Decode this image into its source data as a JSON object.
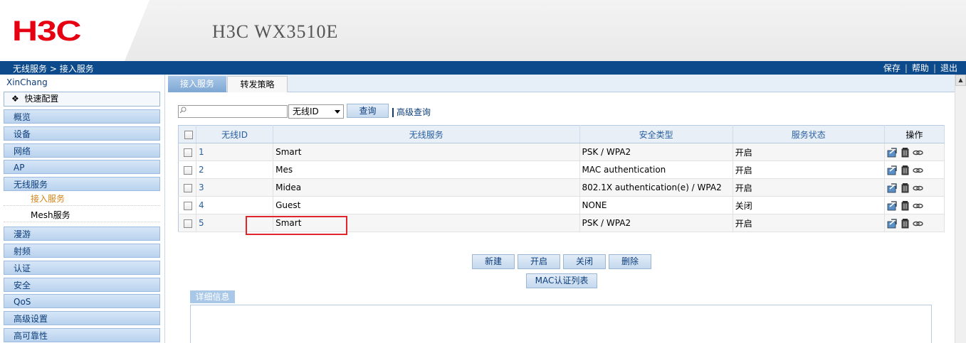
{
  "header": {
    "logo": "H3C",
    "product": "H3C WX3510E"
  },
  "navbar": {
    "crumb_root": "无线服务",
    "crumb_sep": ">",
    "crumb_page": "接入服务",
    "links": {
      "save": "保存",
      "help": "帮助",
      "logout": "退出",
      "sep": "|"
    }
  },
  "sidebar": {
    "site": "XinChang",
    "quick": "快速配置",
    "menu_top": [
      "概览",
      "设备",
      "网络",
      "AP",
      "无线服务"
    ],
    "sub": {
      "access": "接入服务",
      "mesh": "Mesh服务"
    },
    "menu_bottom": [
      "漫游",
      "射频",
      "认证",
      "安全",
      "QoS",
      "高级设置",
      "高可靠性"
    ]
  },
  "tabs": {
    "access": "接入服务",
    "forward": "转发策略"
  },
  "search": {
    "value": "",
    "select_value": "无线ID",
    "query_btn": "查询",
    "advanced": "高级查询"
  },
  "table": {
    "headers": {
      "id": "无线ID",
      "service": "无线服务",
      "security": "安全类型",
      "status": "服务状态",
      "ops": "操作"
    },
    "rows": [
      {
        "id": "1",
        "service": "Smart",
        "security": "PSK / WPA2",
        "status": "开启"
      },
      {
        "id": "2",
        "service": "Mes",
        "security": "MAC authentication",
        "status": "开启"
      },
      {
        "id": "3",
        "service": "Midea",
        "security": "802.1X authentication(e) / WPA2",
        "status": "开启"
      },
      {
        "id": "4",
        "service": "Guest",
        "security": "NONE",
        "status": "关闭"
      },
      {
        "id": "5",
        "service": "Smart",
        "security": "PSK / WPA2",
        "status": "开启"
      }
    ]
  },
  "actions": {
    "new": "新建",
    "enable": "开启",
    "disable": "关闭",
    "delete": "删除",
    "mac_list": "MAC认证列表"
  },
  "details": {
    "label": "详细信息"
  },
  "colors": {
    "brand": "#e60012",
    "navbar": "#0c4a8c",
    "highlight": "#e0262c"
  }
}
